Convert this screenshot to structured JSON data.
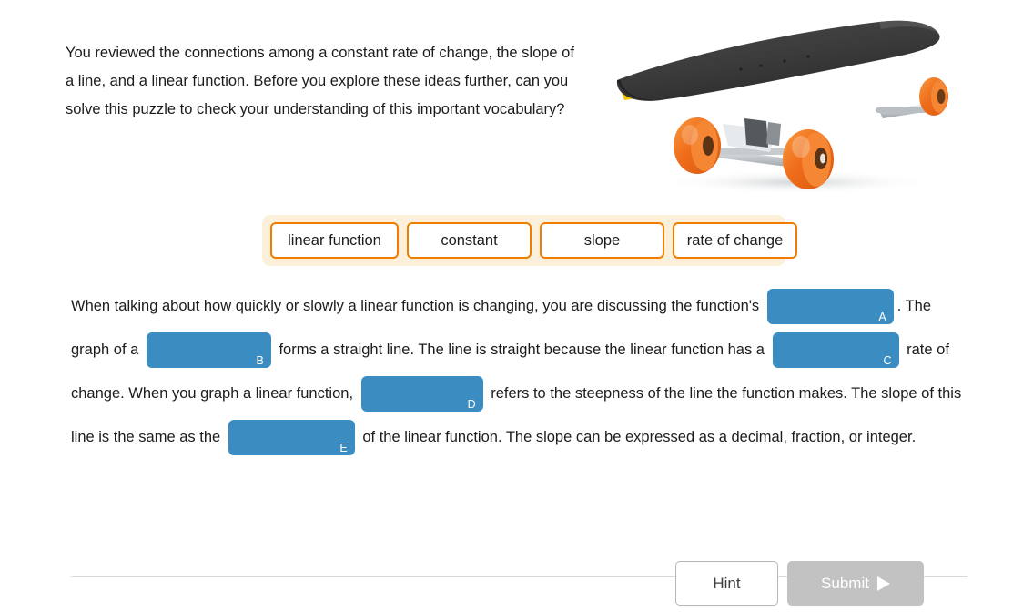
{
  "intro": {
    "paragraph": "You reviewed the connections among a constant rate of change, the slope of a line, and a linear function. Before you explore these ideas further, can you solve this puzzle to check your understanding of this important vocabulary?"
  },
  "illustration": {
    "name": "skateboard-image",
    "alt": "Skateboard with black deck, yellow trim and orange wheels",
    "colors": {
      "deck": "#3a3a3a",
      "deck_dark": "#222222",
      "trim": "#f2c600",
      "wheel": "#ef6c1a",
      "wheel_light": "#f58634",
      "truck": "#cfd3d6"
    }
  },
  "word_bank": {
    "background": "#fdf0db",
    "tile_border": "#f07d00",
    "tiles": [
      {
        "label": "linear function"
      },
      {
        "label": "constant"
      },
      {
        "label": "slope"
      },
      {
        "label": "rate of change"
      }
    ]
  },
  "cloze": {
    "blank_color": "#3a8cc1",
    "segments": [
      {
        "type": "text",
        "text": "When talking about how quickly or slowly a linear function is changing, you are discussing the function's "
      },
      {
        "type": "blank",
        "letter": "A",
        "value": ""
      },
      {
        "type": "text",
        "text": ". The graph of a "
      },
      {
        "type": "blank",
        "letter": "B",
        "value": ""
      },
      {
        "type": "text",
        "text": " forms a straight line. The line is straight because the linear function has a "
      },
      {
        "type": "blank",
        "letter": "C",
        "value": ""
      },
      {
        "type": "text",
        "text": " rate of change. When you graph a linear function, "
      },
      {
        "type": "blank",
        "letter": "D",
        "value": ""
      },
      {
        "type": "text",
        "text": " refers to the steepness of the line the function makes. The slope of this line is the same as the "
      },
      {
        "type": "blank",
        "letter": "E",
        "value": ""
      },
      {
        "type": "text",
        "text": " of the linear function. The slope can be expressed as a decimal, fraction, or integer."
      }
    ],
    "text": {
      "s1": "When talking about how quickly or slowly a linear function is changing, you are discussing the function's ",
      "s2": ". The graph of a ",
      "s3": " forms a straight line. The line is straight because the linear function has a ",
      "s4": " rate of change. When you graph a linear function, ",
      "s5": " refers to the steepness of the line the function makes. The slope of this line is the same as the ",
      "s6": " of the linear function. The slope can be expressed as a decimal, fraction, or integer."
    },
    "letters": {
      "a": "A",
      "b": "B",
      "c": "C",
      "d": "D",
      "e": "E"
    }
  },
  "footer": {
    "hint_label": "Hint",
    "submit_label": "Submit",
    "submit_enabled": false
  }
}
